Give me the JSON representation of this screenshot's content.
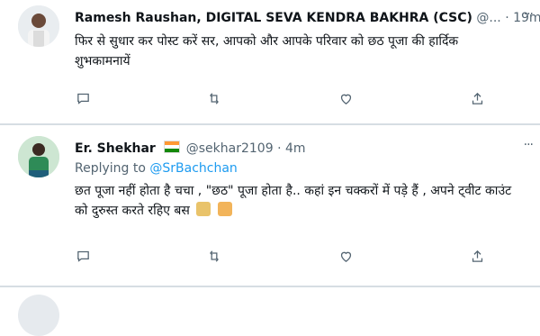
{
  "tweets": [
    {
      "name": "Ramesh Raushan, DIGITAL SEVA KENDRA BAKHRA (CSC)",
      "handle": "@...",
      "time": "19m",
      "text": "फिर से सुधार कर पोस्ट करें सर, आपको और आपके परिवार को छठ पूजा की हार्दिक शुभकामनायें"
    },
    {
      "name": "Er. Shekhar",
      "handle": "@sekhar2109",
      "time": "4m",
      "replying_prefix": "Replying to",
      "replying_to": "@SrBachchan",
      "text": "छत पूजा नहीं होता है चचा , \"छठ\" पूजा होता है.. कहां इन चक्करों में पड़े हैं , अपने ट्वीट काउंट को दुरुस्त करते रहिए बस"
    }
  ],
  "separator_dot": "·",
  "more_label": "···",
  "icons": [
    "reply-icon",
    "retweet-icon",
    "like-icon",
    "share-icon",
    "more-icon",
    "india-flag-icon",
    "emoji-icon"
  ]
}
